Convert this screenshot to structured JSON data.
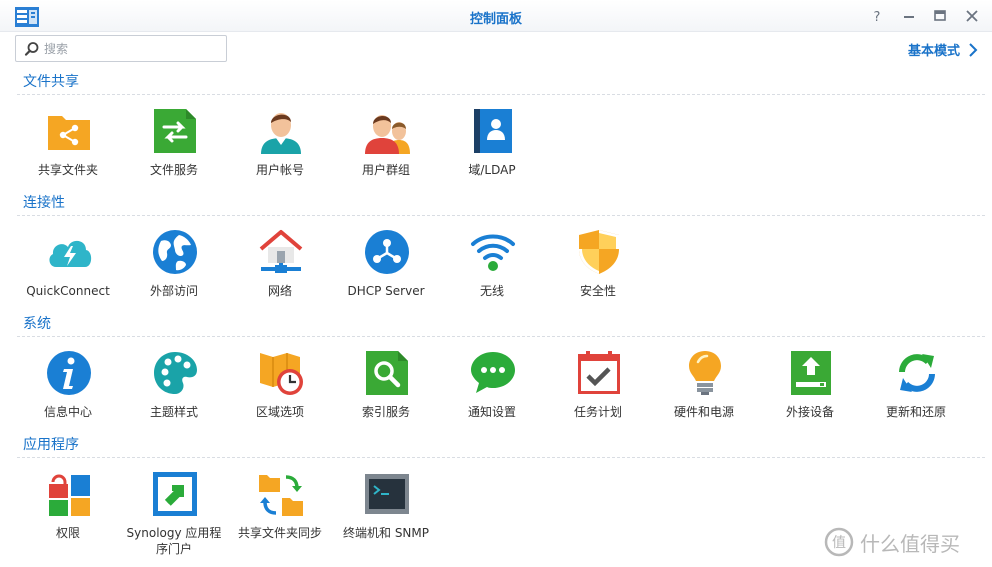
{
  "window": {
    "title": "控制面板",
    "buttons": [
      "help",
      "minimize",
      "maximize",
      "close"
    ]
  },
  "search": {
    "placeholder": "搜索",
    "value": ""
  },
  "mode_link": {
    "label": "基本模式"
  },
  "sections": [
    {
      "title": "文件共享",
      "items": [
        {
          "label": "共享文件夹",
          "icon": "shared-folder-icon"
        },
        {
          "label": "文件服务",
          "icon": "file-services-icon"
        },
        {
          "label": "用户帐号",
          "icon": "user-icon"
        },
        {
          "label": "用户群组",
          "icon": "group-icon"
        },
        {
          "label": "域/LDAP",
          "icon": "domain-ldap-icon"
        }
      ]
    },
    {
      "title": "连接性",
      "items": [
        {
          "label": "QuickConnect",
          "icon": "quickconnect-icon"
        },
        {
          "label": "外部访问",
          "icon": "globe-icon"
        },
        {
          "label": "网络",
          "icon": "house-network-icon"
        },
        {
          "label": "DHCP Server",
          "icon": "dhcp-icon"
        },
        {
          "label": "无线",
          "icon": "wireless-icon"
        },
        {
          "label": "安全性",
          "icon": "shield-icon"
        }
      ]
    },
    {
      "title": "系统",
      "items": [
        {
          "label": "信息中心",
          "icon": "info-icon"
        },
        {
          "label": "主题样式",
          "icon": "palette-icon"
        },
        {
          "label": "区域选项",
          "icon": "region-clock-icon"
        },
        {
          "label": "索引服务",
          "icon": "index-search-icon"
        },
        {
          "label": "通知设置",
          "icon": "chat-bubble-icon"
        },
        {
          "label": "任务计划",
          "icon": "calendar-check-icon"
        },
        {
          "label": "硬件和电源",
          "icon": "light-bulb-icon"
        },
        {
          "label": "外接设备",
          "icon": "upload-device-icon"
        },
        {
          "label": "更新和还原",
          "icon": "refresh-icon"
        }
      ]
    },
    {
      "title": "应用程序",
      "items": [
        {
          "label": "权限",
          "icon": "privileges-icon"
        },
        {
          "label": "Synology 应用程序门户",
          "icon": "app-portal-icon"
        },
        {
          "label": "共享文件夹同步",
          "icon": "folder-sync-icon"
        },
        {
          "label": "终端机和 SNMP",
          "icon": "terminal-icon"
        }
      ]
    }
  ],
  "watermark": {
    "text": "什么值得买"
  },
  "colors": {
    "accent": "#1a73c9",
    "title_bar": "#f3f5f8"
  }
}
